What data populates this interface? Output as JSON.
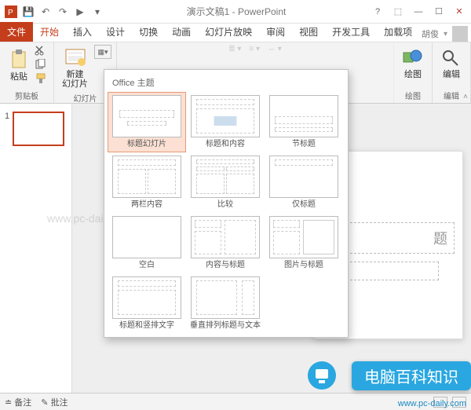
{
  "titlebar": {
    "title": "演示文稿1 - PowerPoint",
    "qat": {
      "save": "💾",
      "undo": "↶",
      "redo": "↷",
      "start": "▶"
    }
  },
  "window_controls": {
    "help": "?",
    "display_opts": "⬚",
    "min": "—",
    "max": "☐",
    "close": "✕"
  },
  "tabs": {
    "file": "文件",
    "home": "开始",
    "insert": "插入",
    "design": "设计",
    "transitions": "切换",
    "animations": "动画",
    "slideshow": "幻灯片放映",
    "review": "审阅",
    "view": "视图",
    "developer": "开发工具",
    "addins": "加载项"
  },
  "user": {
    "name": "胡俊"
  },
  "ribbon": {
    "clipboard": {
      "paste": "粘贴",
      "group": "剪贴板"
    },
    "slides": {
      "new_slide": "新建\n幻灯片",
      "group": "幻灯片"
    },
    "drawing": {
      "draw": "绘图",
      "group": "绘图"
    },
    "editing": {
      "edit": "编辑",
      "group": "编辑"
    }
  },
  "gallery": {
    "header": "Office 主题",
    "layouts": [
      "标题幻灯片",
      "标题和内容",
      "节标题",
      "两栏内容",
      "比较",
      "仅标题",
      "空白",
      "内容与标题",
      "图片与标题",
      "标题和竖排文字",
      "垂直排列标题与文本"
    ]
  },
  "slides_panel": {
    "num1": "1"
  },
  "canvas": {
    "placeholder": "题"
  },
  "status": {
    "notes": "备注",
    "comments": "批注"
  },
  "watermarks": {
    "wm1": "www.pc-daily.com",
    "banner": "电脑百科知识",
    "url": "www.pc-daily.com"
  }
}
